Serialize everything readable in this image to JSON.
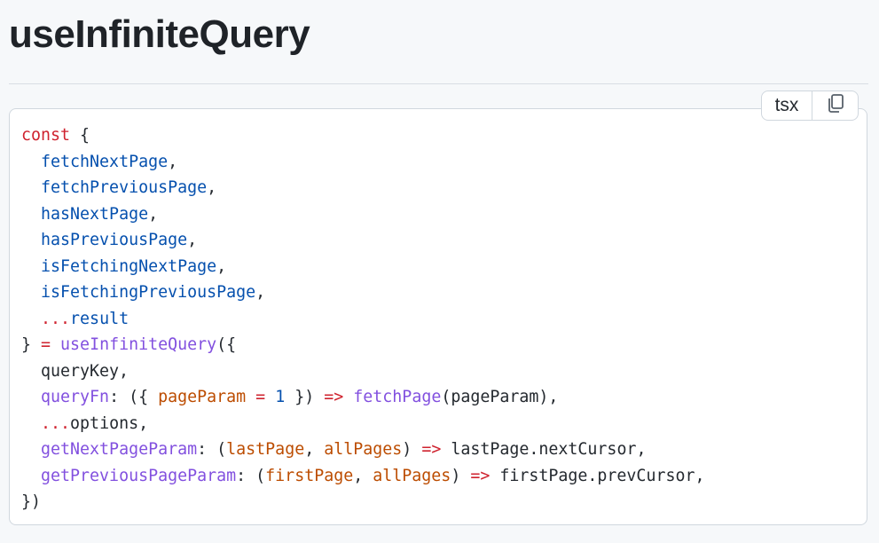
{
  "page": {
    "title": "useInfiniteQuery"
  },
  "code_block": {
    "language": "tsx",
    "copy_icon": "copy-icon",
    "lines": [
      [
        {
          "t": "const",
          "c": "kw"
        },
        {
          "t": " {",
          "c": ""
        }
      ],
      [
        {
          "t": "  ",
          "c": ""
        },
        {
          "t": "fetchNextPage",
          "c": "var"
        },
        {
          "t": ",",
          "c": ""
        }
      ],
      [
        {
          "t": "  ",
          "c": ""
        },
        {
          "t": "fetchPreviousPage",
          "c": "var"
        },
        {
          "t": ",",
          "c": ""
        }
      ],
      [
        {
          "t": "  ",
          "c": ""
        },
        {
          "t": "hasNextPage",
          "c": "var"
        },
        {
          "t": ",",
          "c": ""
        }
      ],
      [
        {
          "t": "  ",
          "c": ""
        },
        {
          "t": "hasPreviousPage",
          "c": "var"
        },
        {
          "t": ",",
          "c": ""
        }
      ],
      [
        {
          "t": "  ",
          "c": ""
        },
        {
          "t": "isFetchingNextPage",
          "c": "var"
        },
        {
          "t": ",",
          "c": ""
        }
      ],
      [
        {
          "t": "  ",
          "c": ""
        },
        {
          "t": "isFetchingPreviousPage",
          "c": "var"
        },
        {
          "t": ",",
          "c": ""
        }
      ],
      [
        {
          "t": "  ",
          "c": ""
        },
        {
          "t": "...",
          "c": "op"
        },
        {
          "t": "result",
          "c": "var"
        }
      ],
      [
        {
          "t": "} ",
          "c": ""
        },
        {
          "t": "=",
          "c": "op"
        },
        {
          "t": " ",
          "c": ""
        },
        {
          "t": "useInfiniteQuery",
          "c": "fn"
        },
        {
          "t": "({",
          "c": ""
        }
      ],
      [
        {
          "t": "  queryKey,",
          "c": ""
        }
      ],
      [
        {
          "t": "  ",
          "c": ""
        },
        {
          "t": "queryFn",
          "c": "fn"
        },
        {
          "t": ": ({ ",
          "c": ""
        },
        {
          "t": "pageParam",
          "c": "param"
        },
        {
          "t": " ",
          "c": ""
        },
        {
          "t": "=",
          "c": "op"
        },
        {
          "t": " ",
          "c": ""
        },
        {
          "t": "1",
          "c": "num"
        },
        {
          "t": " }) ",
          "c": ""
        },
        {
          "t": "=>",
          "c": "op"
        },
        {
          "t": " ",
          "c": ""
        },
        {
          "t": "fetchPage",
          "c": "fn"
        },
        {
          "t": "(pageParam),",
          "c": ""
        }
      ],
      [
        {
          "t": "  ",
          "c": ""
        },
        {
          "t": "...",
          "c": "op"
        },
        {
          "t": "options,",
          "c": ""
        }
      ],
      [
        {
          "t": "  ",
          "c": ""
        },
        {
          "t": "getNextPageParam",
          "c": "fn"
        },
        {
          "t": ": (",
          "c": ""
        },
        {
          "t": "lastPage",
          "c": "param"
        },
        {
          "t": ", ",
          "c": ""
        },
        {
          "t": "allPages",
          "c": "param"
        },
        {
          "t": ") ",
          "c": ""
        },
        {
          "t": "=>",
          "c": "op"
        },
        {
          "t": " lastPage.nextCursor,",
          "c": ""
        }
      ],
      [
        {
          "t": "  ",
          "c": ""
        },
        {
          "t": "getPreviousPageParam",
          "c": "fn"
        },
        {
          "t": ": (",
          "c": ""
        },
        {
          "t": "firstPage",
          "c": "param"
        },
        {
          "t": ", ",
          "c": ""
        },
        {
          "t": "allPages",
          "c": "param"
        },
        {
          "t": ") ",
          "c": ""
        },
        {
          "t": "=>",
          "c": "op"
        },
        {
          "t": " firstPage.prevCursor,",
          "c": ""
        }
      ],
      [
        {
          "t": "})",
          "c": ""
        }
      ]
    ]
  },
  "colors": {
    "keyword": "#cf222e",
    "variable": "#0550ae",
    "function": "#8250df",
    "parameter": "#bc4c00"
  }
}
